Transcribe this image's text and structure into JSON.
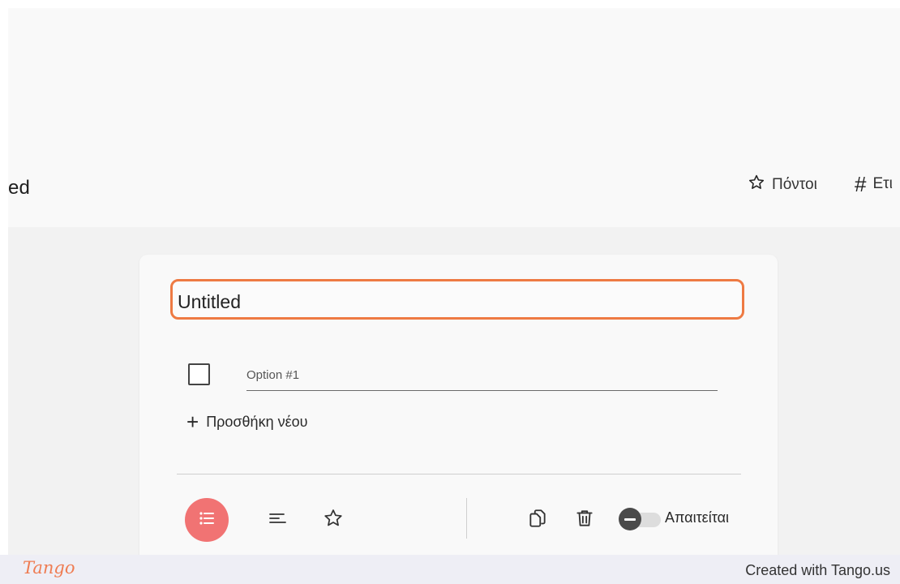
{
  "header": {
    "title_fragment": "ed",
    "points_label": "Πόντοι",
    "label_fragment": "Ετι"
  },
  "question": {
    "title_value": "Untitled",
    "option_1_value": "Option #1",
    "add_new_label": "Προσθήκη νέου"
  },
  "toolbar": {
    "required_label": "Απαιτείται",
    "required_on": false
  },
  "icons": {
    "points": "star-outline-icon",
    "label": "hash-icon",
    "add": "plus-icon",
    "type_list": "list-icon",
    "type_text": "short-text-icon",
    "type_rating": "star-outline-icon",
    "copy": "copy-icon",
    "delete": "trash-icon"
  },
  "colors": {
    "focus_border": "#ee7a43",
    "active_type": "#f17373",
    "tango_brand": "#ef7c52"
  },
  "footer": {
    "logo": "Tango",
    "credit": "Created with Tango.us"
  }
}
